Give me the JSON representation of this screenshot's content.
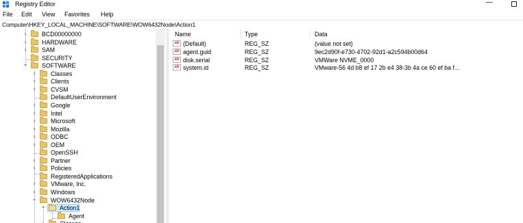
{
  "window": {
    "title": "Registry Editor",
    "minimize_glyph": "—"
  },
  "menu": [
    "File",
    "Edit",
    "View",
    "Favorites",
    "Help"
  ],
  "address": "Computer\\HKEY_LOCAL_MACHINE\\SOFTWARE\\WOW6432Node\\Action1",
  "tree": [
    {
      "label": "BCD00000000",
      "expander": "›"
    },
    {
      "label": "HARDWARE",
      "expander": "›"
    },
    {
      "label": "SAM",
      "expander": "›"
    },
    {
      "label": "SECURITY",
      "expander": ""
    },
    {
      "label": "SOFTWARE",
      "expander": "⌄"
    },
    {
      "label": "Classes",
      "expander": "›"
    },
    {
      "label": "Clients",
      "expander": "›"
    },
    {
      "label": "CVSM",
      "expander": "›"
    },
    {
      "label": "DefaultUserEnvironment",
      "expander": ""
    },
    {
      "label": "Google",
      "expander": "›"
    },
    {
      "label": "Intel",
      "expander": "›"
    },
    {
      "label": "Microsoft",
      "expander": "›"
    },
    {
      "label": "Mozilla",
      "expander": "›"
    },
    {
      "label": "ODBC",
      "expander": "›"
    },
    {
      "label": "OEM",
      "expander": "›"
    },
    {
      "label": "OpenSSH",
      "expander": ""
    },
    {
      "label": "Partner",
      "expander": "›"
    },
    {
      "label": "Policies",
      "expander": "›"
    },
    {
      "label": "RegisteredApplications",
      "expander": ""
    },
    {
      "label": "VMware, Inc.",
      "expander": "›"
    },
    {
      "label": "Windows",
      "expander": "›"
    },
    {
      "label": "WOW6432Node",
      "expander": "⌄"
    },
    {
      "label": "Action1",
      "expander": "⌄"
    },
    {
      "label": "Agent",
      "expander": ""
    },
    {
      "label": "Classes",
      "expander": "›"
    }
  ],
  "columns": {
    "name": "Name",
    "type": "Type",
    "data": "Data"
  },
  "values": [
    {
      "icon": "ab",
      "name": "(Default)",
      "type": "REG_SZ",
      "data": "(value not set)"
    },
    {
      "icon": "ab",
      "name": "agent.guid",
      "type": "REG_SZ",
      "data": "9ec2d90f-e730-4702-92d1-a2c594b00d64"
    },
    {
      "icon": "ab",
      "name": "disk.serial",
      "type": "REG_SZ",
      "data": "VMWare NVME_0000"
    },
    {
      "icon": "ab",
      "name": "system.id",
      "type": "REG_SZ",
      "data": "VMware-56 4d b8 ef 17 2b e4 38-3b 4a ce 60 ef ba f..."
    }
  ]
}
